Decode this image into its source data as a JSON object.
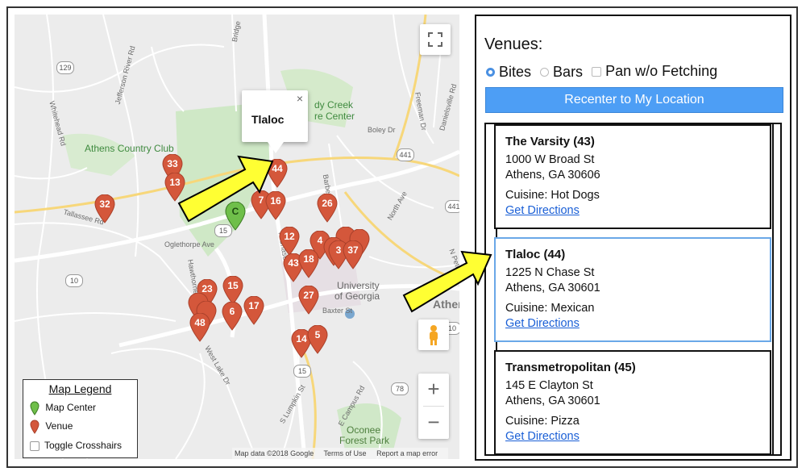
{
  "map": {
    "labels": {
      "athens_country_club": "Athens Country Club",
      "dy_creek": "dy Creek",
      "re_center": "re Center",
      "university": "University",
      "of_georgia": "of Georgia",
      "athens_partial": "Athens",
      "oconee": "Oconee",
      "forest_park": "Forest Park",
      "oglethorpe_ave": "Oglethorpe Ave",
      "n_chase": "N Chase",
      "barber_st": "Barber St",
      "baxter_st": "Baxter St",
      "boley_dr": "Boley Dr",
      "freeman_dr": "Freeman Dr",
      "north_ave": "North Ave",
      "danielsville_rd": "Danielsville Rd",
      "jefferson_river_rd": "Jefferson River Rd",
      "whitehead_rd": "Whitehead Rd",
      "tallassee_rd": "Tallassee Rd",
      "hawthorne": "Hawthorne",
      "west_lake_dr": "West Lake Dr",
      "s_lumpkin_st": "S Lumpkin St",
      "e_campus_rd": "E Campus Rd",
      "n_peter": "N Peter",
      "bridge": "Bridge",
      "highways": [
        "129",
        "10",
        "15",
        "15",
        "441",
        "441",
        "78",
        "10"
      ]
    },
    "info_window": {
      "title": "Tlaloc",
      "close": "×"
    },
    "venue_pins": [
      "33",
      "13",
      "32",
      "44",
      "7",
      "16",
      "26",
      "12",
      "4",
      "43",
      "18",
      "3",
      "37",
      "23",
      "15",
      "6",
      "17",
      "27",
      "48",
      "14",
      "5"
    ],
    "center_pin": "C",
    "legend": {
      "title": "Map Legend",
      "center": "Map Center",
      "venue": "Venue",
      "crosshairs": "Toggle Crosshairs"
    },
    "attribution": {
      "data": "Map data ©2018 Google",
      "terms": "Terms of Use",
      "report": "Report a map error"
    },
    "controls": {
      "zoom_in": "+",
      "zoom_out": "−"
    },
    "colors": {
      "venue_pin": "#d4573b",
      "center_pin": "#6fbf4a",
      "arrow_fill": "#ffff33"
    }
  },
  "panel": {
    "title": "Venues:",
    "options": {
      "bites": "Bites",
      "bars": "Bars",
      "pan": "Pan w/o Fetching"
    },
    "selected_option": "bites",
    "recenter": "Recenter to My Location",
    "accent": "#4d9ef5",
    "venues": [
      {
        "name": "The Varsity (43)",
        "street": "1000 W Broad St",
        "city": "Athens, GA 30606",
        "cuisine": "Cuisine: Hot Dogs",
        "directions": "Get Directions"
      },
      {
        "name": "Tlaloc (44)",
        "street": "1225 N Chase St",
        "city": "Athens, GA 30601",
        "cuisine": "Cuisine: Mexican",
        "directions": "Get Directions"
      },
      {
        "name": "Transmetropolitan (45)",
        "street": "145 E Clayton St",
        "city": "Athens, GA 30601",
        "cuisine": "Cuisine: Pizza",
        "directions": "Get Directions"
      }
    ]
  }
}
